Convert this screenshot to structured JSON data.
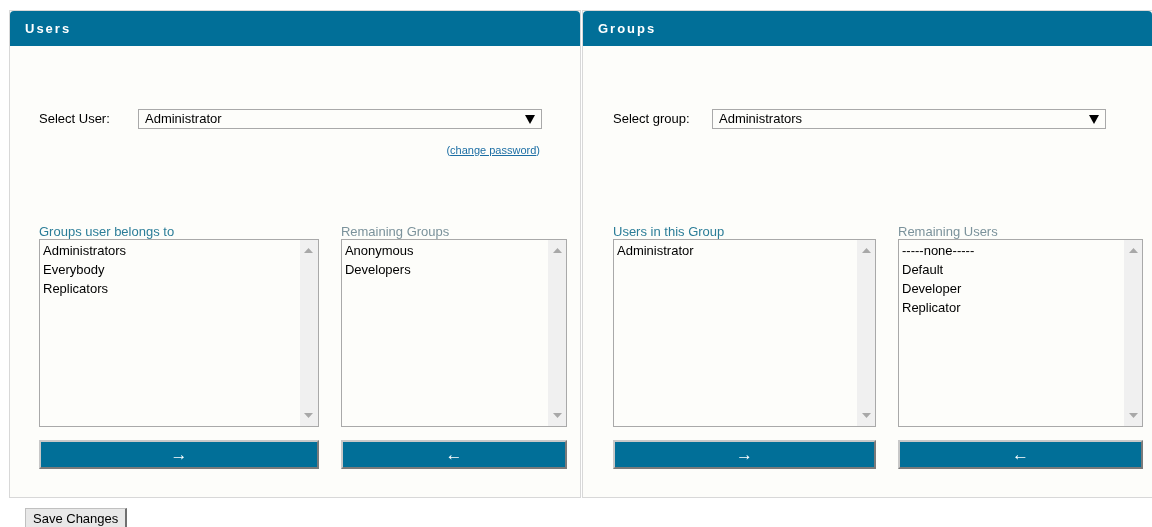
{
  "panels": [
    {
      "title": "Users",
      "select": {
        "label": "Select User:",
        "value": "Administrator"
      },
      "link": {
        "open": "(",
        "text": "change password",
        "close": ")"
      },
      "lists": [
        {
          "label": "Groups user belongs to",
          "items": [
            "Administrators",
            "Everybody",
            "Replicators"
          ],
          "button": "→"
        },
        {
          "label": "Remaining Groups",
          "items": [
            "Anonymous",
            "Developers"
          ],
          "button": "←"
        }
      ]
    },
    {
      "title": "Groups",
      "select": {
        "label": "Select group:",
        "value": "Administrators"
      },
      "lists": [
        {
          "label": "Users in this Group",
          "items": [
            "Administrator"
          ],
          "button": "→"
        },
        {
          "label": "Remaining Users",
          "items": [
            "-----none-----",
            "Default",
            "Developer",
            "Replicator"
          ],
          "button": "←"
        }
      ]
    }
  ],
  "save_button": "Save Changes"
}
